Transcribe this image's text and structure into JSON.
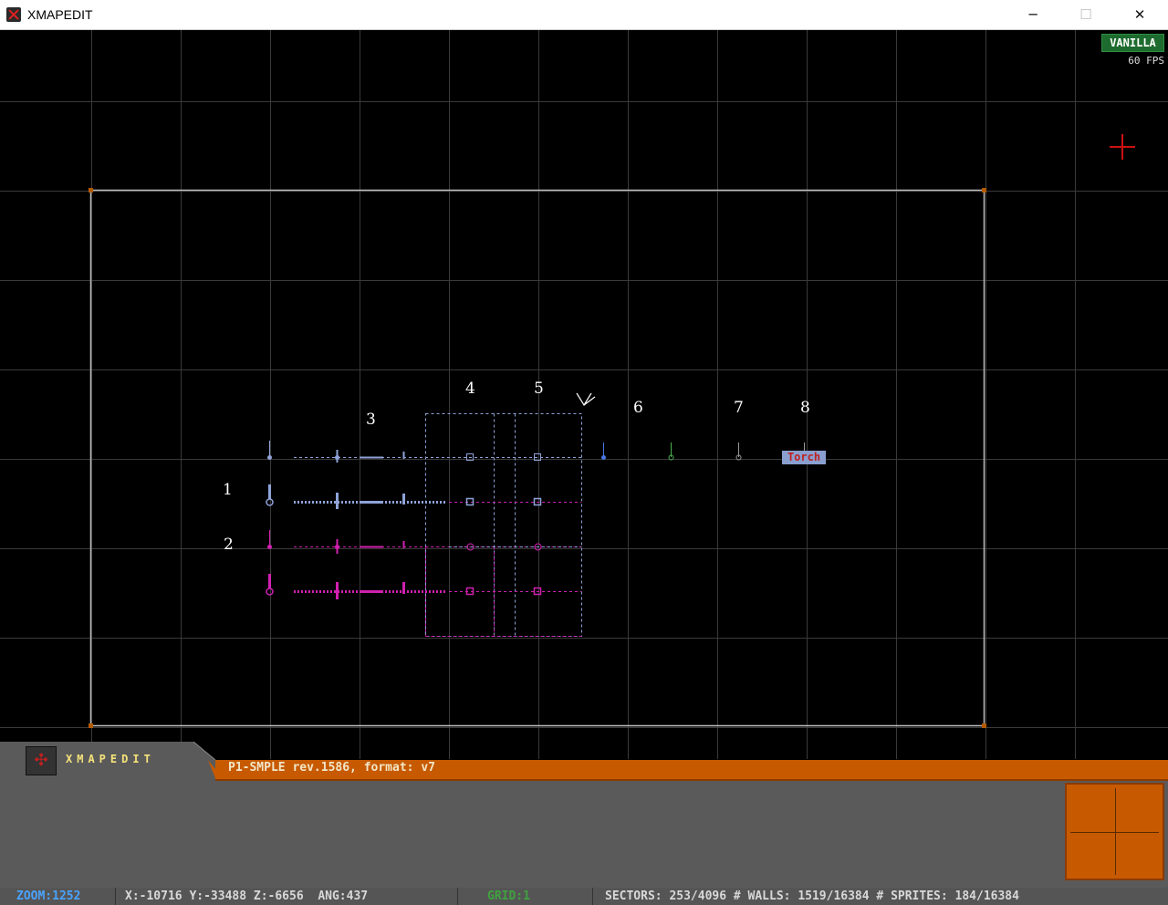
{
  "window": {
    "title": "XMAPEDIT",
    "controls": {
      "minimize": "─",
      "maximize": "☐",
      "close": "✕"
    }
  },
  "badge": {
    "label": "VANILLA"
  },
  "fps": "60 FPS",
  "labels": [
    "1",
    "2",
    "3",
    "4",
    "5",
    "6",
    "7",
    "8"
  ],
  "sprite_label": "Torch",
  "panel": {
    "logo_text": "XMAPEDIT",
    "map_info": "P1-SMPLE rev.1586, format: v7"
  },
  "status": {
    "zoom": "ZOOM:1252",
    "position": "X:-10716 Y:-33488 Z:-6656  ANG:437",
    "grid": "GRID:1",
    "stats": "SECTORS: 253/4096 # WALLS: 1519/16384 # SPRITES: 184/16384"
  },
  "colors": {
    "accent": "#c75a00",
    "vanilla": "#1d6b2e",
    "sprite_blue": "#8fa3d8",
    "sprite_magenta": "#d020b0"
  }
}
